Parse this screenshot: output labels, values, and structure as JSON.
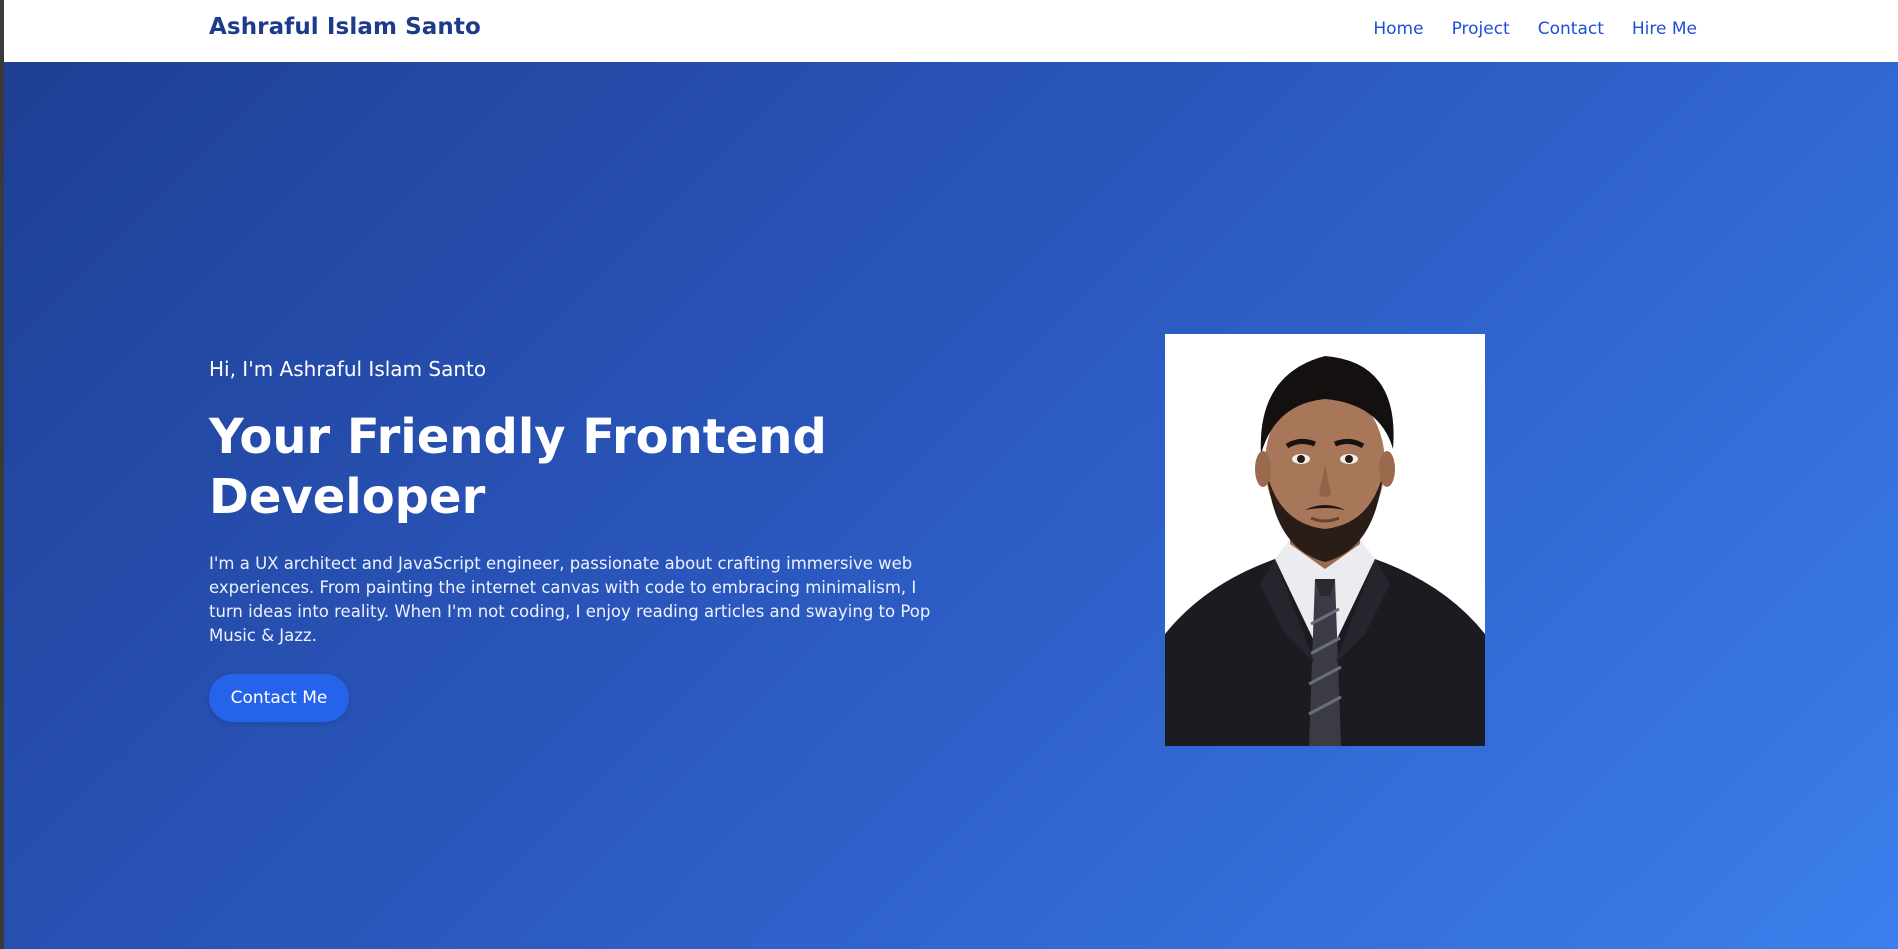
{
  "brand": "Ashraful Islam Santo",
  "nav": {
    "items": [
      "Home",
      "Project",
      "Contact",
      "Hire Me"
    ]
  },
  "hero": {
    "greeting": "Hi, I'm Ashraful Islam Santo",
    "headline": "Your Friendly Frontend Developer",
    "bio": "I'm a UX architect and JavaScript engineer, passionate about crafting immersive web experiences. From painting the internet canvas with code to embracing minimalism, I turn ideas into reality. When I'm not coding, I enjoy reading articles and swaying to Pop Music & Jazz.",
    "cta_label": "Contact Me"
  },
  "colors": {
    "brand": "#1e3a8a",
    "nav_link": "#1d4ed8",
    "button": "#2563eb",
    "gradient_start": "#1f3f94",
    "gradient_end": "#3b7fec"
  }
}
